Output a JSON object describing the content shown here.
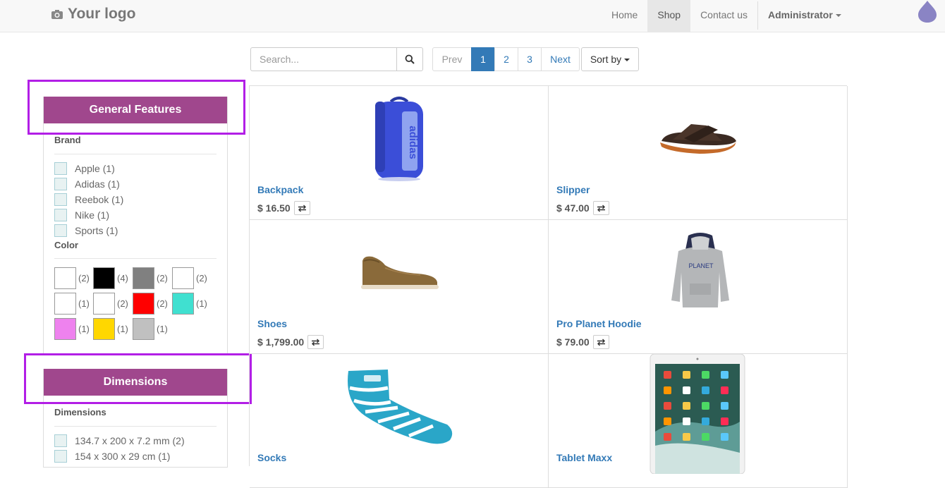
{
  "navbar": {
    "logo_text": "Your logo",
    "items": [
      {
        "label": "Home",
        "active": false
      },
      {
        "label": "Shop",
        "active": true
      },
      {
        "label": "Contact us",
        "active": false
      }
    ],
    "user_label": "Administrator"
  },
  "search": {
    "placeholder": "Search...",
    "value": ""
  },
  "pager": {
    "prev": "Prev",
    "pages": [
      "1",
      "2",
      "3"
    ],
    "current": "1",
    "next": "Next"
  },
  "sort_label": "Sort by",
  "sidebar": {
    "general": {
      "title": "General Features",
      "brand_label": "Brand",
      "brands": [
        "Apple (1)",
        "Adidas (1)",
        "Reebok (1)",
        "Nike (1)",
        "Sports (1)"
      ],
      "color_label": "Color",
      "colors": [
        {
          "color": "#ffffff",
          "count": "(2)"
        },
        {
          "color": "#000000",
          "count": "(4)"
        },
        {
          "color": "#808080",
          "count": "(2)"
        },
        {
          "color": "#ffffff",
          "count": "(2)"
        },
        {
          "color": "#ffffff",
          "count": "(1)"
        },
        {
          "color": "#ffffff",
          "count": "(2)"
        },
        {
          "color": "#ff0000",
          "count": "(2)"
        },
        {
          "color": "#40e0d0",
          "count": "(1)"
        },
        {
          "color": "#ee82ee",
          "count": "(1)"
        },
        {
          "color": "#ffd700",
          "count": "(1)"
        },
        {
          "color": "#c0c0c0",
          "count": "(1)"
        }
      ]
    },
    "dimensions": {
      "title": "Dimensions",
      "label": "Dimensions",
      "values": [
        "134.7 x 200 x 7.2 mm (2)",
        "154 x 300 x 29 cm (1)"
      ]
    }
  },
  "products": [
    {
      "name": "Backpack",
      "price": "$ 16.50",
      "icon": "backpack-image"
    },
    {
      "name": "Slipper",
      "price": "$ 47.00",
      "icon": "slipper-image"
    },
    {
      "name": "Shoes",
      "price": "$ 1,799.00",
      "icon": "shoe-image"
    },
    {
      "name": "Pro Planet Hoodie",
      "price": "$ 79.00",
      "icon": "hoodie-image"
    },
    {
      "name": "Socks",
      "price": "",
      "icon": "sock-image"
    },
    {
      "name": "Tablet Maxx",
      "price": "",
      "icon": "tablet-image"
    }
  ],
  "colors": {
    "accent": "#a0478d",
    "highlight": "#b21ee6",
    "link": "#337ab7"
  }
}
